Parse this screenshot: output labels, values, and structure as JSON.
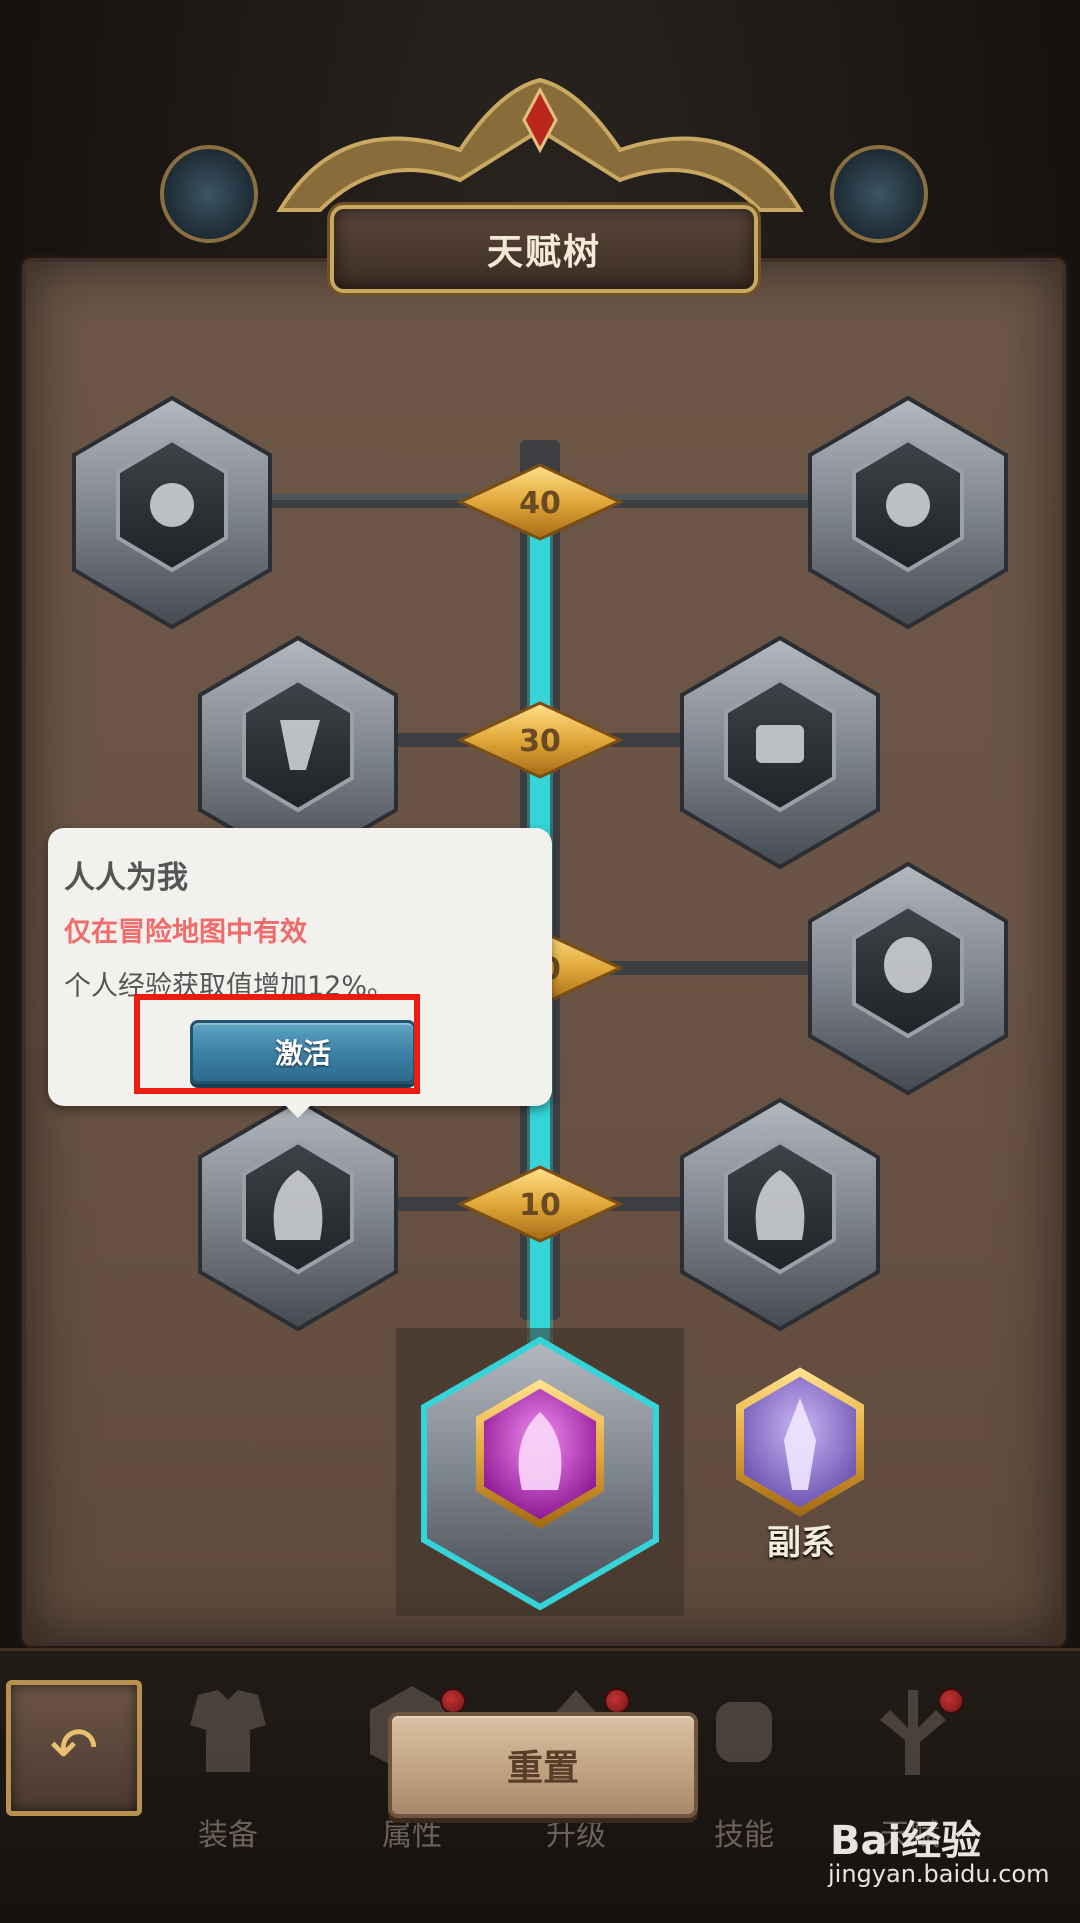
{
  "header": {
    "title": "天赋树"
  },
  "tree": {
    "tiers": [
      {
        "level": "40",
        "left_icon": "coins-icon",
        "right_icon": "claw-ring-icon"
      },
      {
        "level": "30",
        "left_icon": "axe-icon",
        "right_icon": "treasure-chest-icon"
      },
      {
        "level": "20",
        "left_icon": "hidden-node-icon",
        "right_icon": "skull-icon"
      },
      {
        "level": "10",
        "left_icon": "hooded-figure-icon",
        "right_icon": "masked-figure-icon"
      }
    ],
    "root_icon": "crown-flame-icon",
    "sub_icon": "dagger-crest-icon",
    "sub_label": "副系"
  },
  "tooltip": {
    "title": "人人为我",
    "condition": "仅在冒险地图中有效",
    "description": "个人经验获取值增加12%。",
    "button_label": "激活"
  },
  "bottom_nav": {
    "back_icon": "back-arrow-icon",
    "reset_label": "重置",
    "items": [
      {
        "label": "装备",
        "icon": "armor-icon",
        "badge": false
      },
      {
        "label": "属性",
        "icon": "gem-icon",
        "badge": true
      },
      {
        "label": "升级",
        "icon": "upgrade-icon",
        "badge": true
      },
      {
        "label": "技能",
        "icon": "fist-icon",
        "badge": false
      },
      {
        "label": "天赋",
        "icon": "tree-icon",
        "badge": true
      }
    ]
  },
  "watermark": {
    "logo": "Bai经验",
    "url": "jingyan.baidu.com"
  },
  "colors": {
    "tooltip_condition": "#f06b6b",
    "highlight_box": "#ee1c0e",
    "active_path": "#35d4d8",
    "activate_button": "#3b7fa4"
  }
}
